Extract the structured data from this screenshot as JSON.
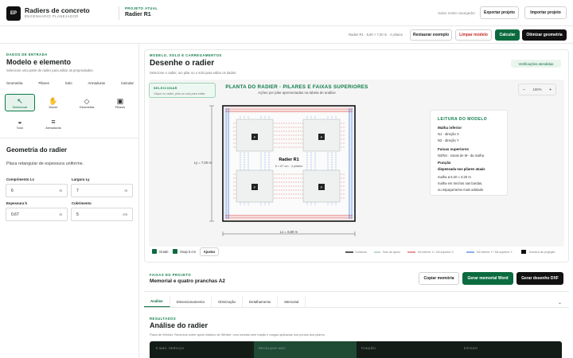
{
  "header": {
    "logo": "EP",
    "brand": "Radiers de concreto",
    "brand_sub": "ENGENHARIO PLANEJADOR",
    "project_label": "PROJETO ATUAL",
    "project_name": "Radier R1",
    "saved": "Salvo neste navegador",
    "export": "Exportar projeto",
    "import": "Importar projeto"
  },
  "toolbar": {
    "summary": "Radier R1 · 6,80 × 7,00 m · 4 pilares",
    "restore": "Restaurar exemplo",
    "clear": "Limpar modelo",
    "calc": "Calcular",
    "optimize": "Otimizar geometria"
  },
  "sidebar": {
    "sec": "DADOS DE ENTRADA",
    "title": "Modelo e elemento",
    "desc": "Selecione uma parte do radier para editar as propriedades.",
    "tabs": [
      "Geometria",
      "Pilares",
      "Solo",
      "Armaduras",
      "Calcular"
    ],
    "tools": [
      {
        "icon": "↖",
        "label": "Selecionar"
      },
      {
        "icon": "✋",
        "label": "Mover"
      },
      {
        "icon": "◇",
        "label": "Geometria"
      },
      {
        "icon": "▣",
        "label": "Pilares"
      },
      {
        "icon": "◒",
        "label": "Solo"
      },
      {
        "icon": "≡",
        "label": "Armaduras"
      }
    ],
    "geo_title": "Geometria do radier",
    "geo_desc": "Placa retangular de espessura uniforme.",
    "fields": [
      {
        "label": "Comprimento Lx",
        "value": "6",
        "unit": "m"
      },
      {
        "label": "Largura Ly",
        "value": "7",
        "unit": "m"
      },
      {
        "label": "Espessura h",
        "value": "0.67",
        "unit": "m"
      },
      {
        "label": "Cobrimento",
        "value": "5",
        "unit": "cm"
      }
    ]
  },
  "main": {
    "sec": "MODELO, SOLO E CARREGAMENTOS",
    "title": "Desenhe o radier",
    "desc": "Selecione o radier, um pilar ou o solo para editar os dados.",
    "badge": "Verificações atendidas",
    "sel_lbl": "SELECIONAR",
    "sel_desc": "Clique no radier, pilar ou solo para editar",
    "zoom": "100%",
    "zoom_minus": "−",
    "zoom_plus": "+",
    "plan_title": "PLANTA DO RADIER · PILARES E FAIXAS SUPERIORES",
    "plan_sub": "Ações por pilar apresentadas na tabela de análise",
    "slab_name": "Radier R1",
    "slab_dims": "6 × 67 cm · 4 pilares",
    "pilar_tag": "P",
    "dim_x": "Lx = 6,80 m",
    "dim_y": "Ly = 7,00 m",
    "legend": {
      "title": "LEITURA DO MODELO",
      "l1": "Malha inferior",
      "l2": "N1 · direção X",
      "l3": "N2 · direção Y",
      "l4": "Faixas superiores",
      "l5": "N3/N4 · zonas de M− da malha",
      "l6": "Punção",
      "l7": "dispensada nos pilares atuais",
      "l8": "malha ø 6.20 ≈ 0.20 m",
      "l9": "malha em trechos nas bordas,",
      "l10": "ou espaçamento mais adotado"
    },
    "chk1": "Grade",
    "chk2": "Snap 5 cm",
    "adjust": "Ajustar",
    "leg_bottom": [
      "Contorno",
      "Solo de apoio",
      "N3 inferior X / N4 superior X",
      "N2 inferior Y / N4 superior Y",
      "Sombra de projeção"
    ]
  },
  "memorial": {
    "sec": "FAIXAS DO PROJETO",
    "title": "Memorial e quatro pranchas A2",
    "copy": "Copiar memória",
    "word": "Gerar memorial Word",
    "dxf": "Gerar desenho DXF"
  },
  "results": {
    "tabs": [
      "Análise",
      "Dimensionamento",
      "Otimização",
      "Detalhamento",
      "Memorial"
    ],
    "sec": "RESULTADOS",
    "title": "Análise do radier",
    "desc": "Placa de Winkler. Recursos sobre apoio elástico de Winkler, com contato sem tração e cargas aplicadas nos pontos dos pilares.",
    "cells": [
      "E MÁX. SERVIÇO",
      "RECALQUE MÁX.",
      "PUNÇÃO",
      "ESTADO"
    ]
  },
  "colors": {
    "accent": "#0b6b3f",
    "red": "#d32f2f",
    "blue": "#1e5bd8"
  }
}
